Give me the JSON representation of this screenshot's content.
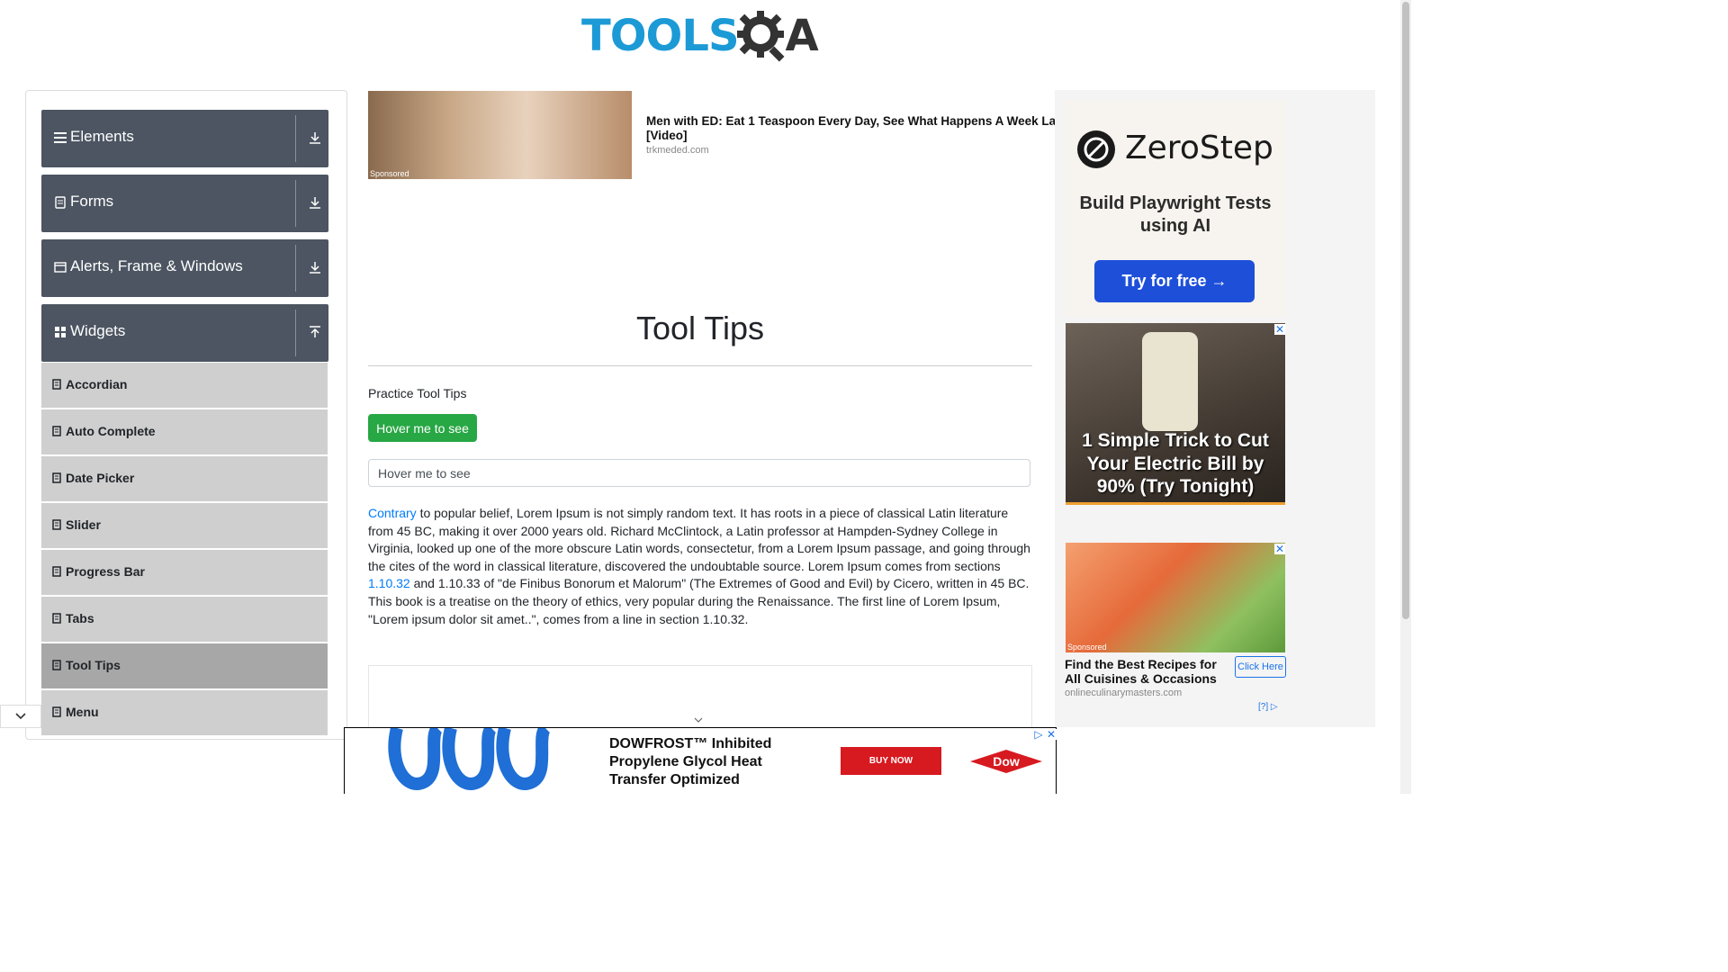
{
  "logo": {
    "part1": "TOOLS",
    "part2": "A"
  },
  "sidebar": {
    "groups": [
      {
        "label": "Elements",
        "icon": "hamburger-icon",
        "state": "collapsed"
      },
      {
        "label": "Forms",
        "icon": "document-icon",
        "state": "collapsed"
      },
      {
        "label": "Alerts, Frame & Windows",
        "icon": "window-icon",
        "state": "collapsed"
      },
      {
        "label": "Widgets",
        "icon": "grid-icon",
        "state": "expanded"
      }
    ],
    "items": [
      {
        "label": "Accordian",
        "active": false
      },
      {
        "label": "Auto Complete",
        "active": false
      },
      {
        "label": "Date Picker",
        "active": false
      },
      {
        "label": "Slider",
        "active": false
      },
      {
        "label": "Progress Bar",
        "active": false
      },
      {
        "label": "Tabs",
        "active": false
      },
      {
        "label": "Tool Tips",
        "active": true
      },
      {
        "label": "Menu",
        "active": false
      }
    ]
  },
  "ad_top": {
    "sponsored": "Sponsored",
    "title_line1": "Men with ED: Eat 1 Teaspoon Every Day, See What Happens A Week La",
    "title_line2": "[Video]",
    "domain": "trkmeded.com"
  },
  "main": {
    "title": "Tool Tips",
    "practice_label": "Practice Tool Tips",
    "hover_button": "Hover me to see",
    "hover_input_placeholder": "Hover me to see",
    "paragraph": {
      "link1": "Contrary",
      "text1": " to popular belief, Lorem Ipsum is not simply random text. It has roots in a piece of classical Latin literature from 45 BC, making it over 2000 years old. Richard McClintock, a Latin professor at Hampden-Sydney College in Virginia, looked up one of the more obscure Latin words, consectetur, from a Lorem Ipsum passage, and going through the cites of the word in classical literature, discovered the undoubtable source. Lorem Ipsum comes from sections ",
      "link2": "1.10.32",
      "text2": " and 1.10.33 of \"de Finibus Bonorum et Malorum\" (The Extremes of Good and Evil) by Cicero, written in 45 BC. This book is a treatise on the theory of ethics, very popular during the Renaissance. The first line of Lorem Ipsum, \"Lorem ipsum dolor sit amet..\", comes from a line in section 1.10.32."
    }
  },
  "right_ads": {
    "zerostep": {
      "name": "ZeroStep",
      "tagline": "Build Playwright Tests using AI",
      "cta": "Try for free →"
    },
    "electric": {
      "text": "1 Simple Trick to Cut Your Electric Bill by 90% (Try Tonight)"
    },
    "recipes": {
      "sponsored": "Sponsored",
      "title": "Find the Best Recipes for All Cuisines & Occasions",
      "domain": "onlineculinarymasters.com",
      "cta": "Click Here",
      "choices": "[?]"
    }
  },
  "bottom_ad": {
    "product": "DOWFROST™ Inhibited Propylene Glycol Heat Transfer Optimized",
    "cta": "BUY NOW",
    "brand": "Dow"
  },
  "colors": {
    "sidebar_group": "#4c5561",
    "sidebar_item": "#cfcfcf",
    "sidebar_active": "#a7a7a7",
    "button_green": "#28a745",
    "link": "#007bff",
    "logo_blue": "#1c9ad6"
  }
}
